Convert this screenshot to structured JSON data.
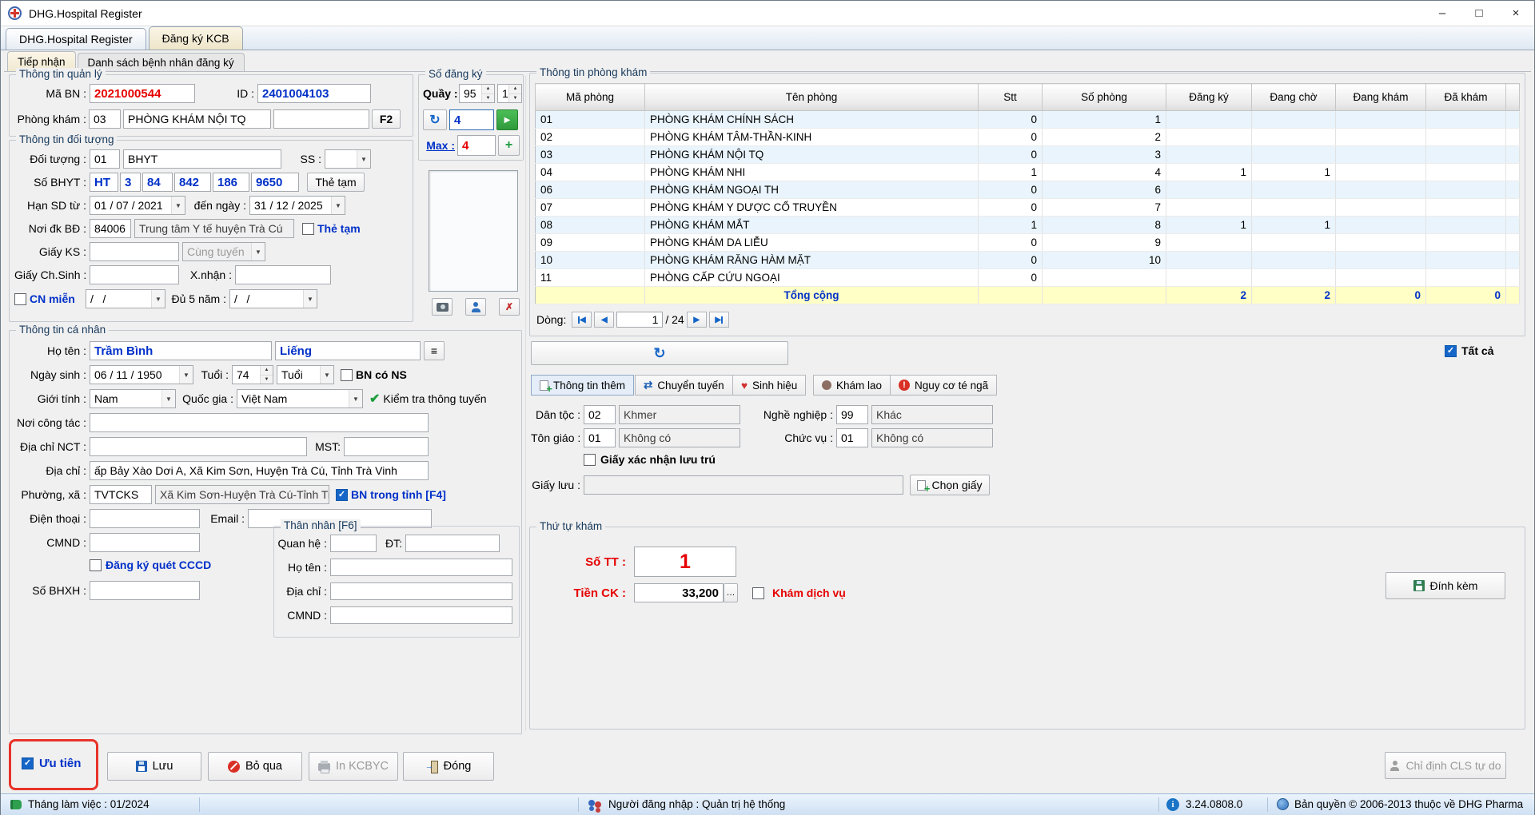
{
  "window": {
    "title": "DHG.Hospital Register",
    "minimize": "–",
    "maximize": "□",
    "close": "×"
  },
  "tabs": {
    "main_1": "DHG.Hospital Register",
    "main_2": "Đăng ký KCB",
    "inner_1": "Tiếp nhận",
    "inner_2": "Danh sách bệnh nhân đăng ký"
  },
  "management": {
    "title": "Thông tin quản lý",
    "ma_bn_label": "Mã BN :",
    "ma_bn": "2021000544",
    "id_label": "ID :",
    "id": "2401004103",
    "phong_kham_label": "Phòng khám :",
    "phong_kham_code": "03",
    "phong_kham_name": "PHÒNG KHÁM NỘI TQ",
    "f2": "F2"
  },
  "so_dang_ky": {
    "title": "Số đăng ký",
    "quay_label": "Quầy :",
    "quay": "95",
    "so_luong": "1",
    "current": "4",
    "max_label": "Max :",
    "max": "4"
  },
  "doi_tuong": {
    "title": "Thông tin đối tượng",
    "doi_tuong_label": "Đối tượng :",
    "code": "01",
    "name": "BHYT",
    "ss_label": "SS :",
    "so_bhyt_label": "Số BHYT :",
    "bhyt_1": "HT",
    "bhyt_2": "3",
    "bhyt_3": "84",
    "bhyt_4": "842",
    "bhyt_5": "186",
    "bhyt_6": "9650",
    "the_tam_button": "Thẻ tạm",
    "han_sd_label": "Hạn SD từ :",
    "han_tu": "01 / 07 / 2021",
    "den_ngay_label": "đến ngày :",
    "han_den": "31 / 12 / 2025",
    "noi_dk_label": "Nơi đk BĐ :",
    "noi_dk_code": "84006",
    "noi_dk_name": "Trung tâm Y tế huyện Trà Cú",
    "the_tam_checkbox": "Thẻ tạm",
    "giay_ks_label": "Giấy KS :",
    "cung_tuyen": "Cùng tuyến",
    "giay_chsinh_label": "Giấy Ch.Sinh :",
    "x_nhan_label": "X.nhận :",
    "cn_mien_label": "CN miễn",
    "cn_mien_date": "/   /",
    "du_5_nam_label": "Đủ 5 năm :",
    "du_5_nam_date": "/   /"
  },
  "ca_nhan": {
    "title": "Thông tin cá nhân",
    "ho_ten_label": "Họ tên :",
    "ho": "Trầm Bình",
    "ten": "Liếng",
    "ngay_sinh_label": "Ngày sinh :",
    "ngay_sinh": "06 / 11 / 1950",
    "tuoi_label": "Tuổi :",
    "tuoi": "74",
    "tuoi_don_vi": "Tuổi",
    "bn_co_ns_label": "BN có NS",
    "gioi_tinh_label": "Giới tính :",
    "gioi_tinh": "Nam",
    "quoc_gia_label": "Quốc gia :",
    "quoc_gia": "Việt Nam",
    "kiem_tra_label": "Kiểm tra thông tuyến",
    "noi_cong_tac_label": "Nơi công tác :",
    "dia_chi_nct_label": "Địa chỉ NCT :",
    "mst_label": "MST:",
    "dia_chi_label": "Địa chỉ :",
    "dia_chi": "ấp Bảy Xào Dơi A, Xã Kim Sơn, Huyện Trà Cú, Tỉnh Trà Vinh",
    "phuong_xa_label": "Phường, xã :",
    "phuong_xa_code": "TVTCKS",
    "phuong_xa_name": "Xã Kim Sơn-Huyện Trà Cú-Tỉnh Trà Vinh",
    "bn_trong_tinh_label": "BN trong tỉnh [F4]",
    "dien_thoai_label": "Điện thoại :",
    "email_label": "Email :",
    "cmnd_label": "CMND :",
    "cccd_label": "Đăng ký quét CCCD",
    "so_bhxh_label": "Số BHXH :"
  },
  "than_nhan": {
    "title": "Thân nhân [F6]",
    "quan_he_label": "Quan hệ :",
    "dt_label": "ĐT:",
    "ho_ten_label": "Họ tên :",
    "dia_chi_label": "Địa chỉ :",
    "cmnd_label": "CMND :"
  },
  "clinic_panel": {
    "title": "Thông tin phòng khám",
    "columns": [
      "Mã phòng",
      "Tên phòng",
      "Stt",
      "Số phòng",
      "Đăng ký",
      "Đang chờ",
      "Đang khám",
      "Đã khám"
    ],
    "rows": [
      [
        "01",
        "PHÒNG KHÁM CHÍNH SÁCH",
        "0",
        "1",
        "",
        "",
        "",
        ""
      ],
      [
        "02",
        "PHÒNG KHÁM TÂM-THẦN-KINH",
        "0",
        "2",
        "",
        "",
        "",
        ""
      ],
      [
        "03",
        "PHÒNG KHÁM NỘI TQ",
        "0",
        "3",
        "",
        "",
        "",
        ""
      ],
      [
        "04",
        "PHÒNG KHÁM NHI",
        "1",
        "4",
        "1",
        "1",
        "",
        ""
      ],
      [
        "06",
        "PHÒNG KHÁM NGOẠI TH",
        "0",
        "6",
        "",
        "",
        "",
        ""
      ],
      [
        "07",
        "PHÒNG KHÁM Y DƯỢC CỔ TRUYỀN",
        "0",
        "7",
        "",
        "",
        "",
        ""
      ],
      [
        "08",
        "PHÒNG KHÁM MẮT",
        "1",
        "8",
        "1",
        "1",
        "",
        ""
      ],
      [
        "09",
        "PHÒNG KHÁM DA LIỄU",
        "0",
        "9",
        "",
        "",
        "",
        ""
      ],
      [
        "10",
        "PHÒNG KHÁM RĂNG HÀM MẶT",
        "0",
        "10",
        "",
        "",
        "",
        ""
      ],
      [
        "11",
        "PHÒNG CẤP CỨU NGOẠI",
        "0",
        "",
        "",
        "",
        "",
        ""
      ]
    ],
    "total_label": "Tổng cộng",
    "total_dang_ky": "2",
    "total_dang_cho": "2",
    "total_dang_kham": "0",
    "total_da_kham": "0",
    "dong_label": "Dòng:",
    "page_current": "1",
    "page_total": "/ 24",
    "tat_ca_label": "Tất cả"
  },
  "detail_tabs": {
    "tab_1": "Thông tin thêm",
    "tab_2": "Chuyển tuyến",
    "tab_3": "Sinh hiệu",
    "tab_4": "Khám lao",
    "tab_5": "Nguy cơ té ngã"
  },
  "extra": {
    "dan_toc_label": "Dân tộc :",
    "dan_toc_code": "02",
    "dan_toc_name": "Khmer",
    "nghe_nghiep_label": "Nghề nghiệp :",
    "nghe_nghiep_code": "99",
    "nghe_nghiep_name": "Khác",
    "ton_giao_label": "Tôn giáo :",
    "ton_giao_code": "01",
    "ton_giao_name": "Không có",
    "chuc_vu_label": "Chức vụ :",
    "chuc_vu_code": "01",
    "chuc_vu_name": "Không có",
    "giay_xn_label": "Giấy xác nhận lưu trú",
    "giay_luu_label": "Giấy lưu :",
    "chon_giay_button": "Chọn giấy"
  },
  "queue": {
    "title": "Thứ tự khám",
    "so_tt_label": "Số TT :",
    "so_tt": "1",
    "tien_ck_label": "Tiền CK :",
    "tien_ck": "33,200",
    "kham_dich_vu_label": "Khám dịch vụ",
    "dinh_kem_button": "Đính kèm"
  },
  "actions": {
    "uu_tien_label": "Ưu tiên",
    "luu": "Lưu",
    "bo_qua": "Bỏ qua",
    "in_kcbyc": "In KCBYC",
    "dong": "Đóng",
    "chi_dinh_cls": "Chỉ định CLS tự do"
  },
  "statusbar": {
    "thang_lam_viec": "Tháng làm việc : 01/2024",
    "nguoi_dang_nhap": "Người đăng nhập : Quản trị hệ thống",
    "version": "3.24.0808.0",
    "copyright": "Bản quyền © 2006-2013 thuộc về DHG Pharma"
  },
  "checks": {
    "the_tam": false,
    "cn_mien": false,
    "bn_co_ns": false,
    "bn_trong_tinh": true,
    "cccd": false,
    "giay_xn": false,
    "kham_dich_vu": false,
    "tat_ca": true,
    "uu_tien": true
  },
  "colors": {
    "accent_blue": "#0030c8",
    "value_red": "#e60000",
    "total_row_bg": "#ffffc6",
    "status_bar_bg": "#d9e7f6",
    "annotation_red": "#e8332a"
  },
  "icons": {
    "refresh": "↻",
    "play": "▶",
    "plus": "+",
    "menu": "≡",
    "check": "✓",
    "green_check": "✔",
    "arrow_left": "◀",
    "arrow_right": "▶",
    "dropdown": "▼",
    "up": "▲",
    "down": "▼",
    "more": "…",
    "del": "✗"
  }
}
